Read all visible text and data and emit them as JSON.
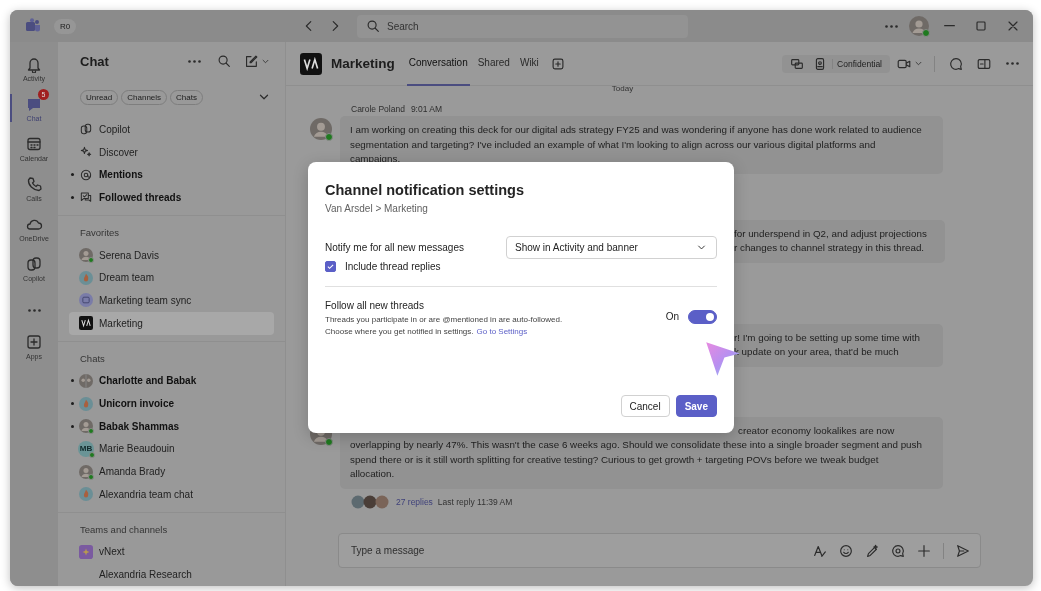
{
  "title_bar": {
    "account": "R0",
    "search": {
      "placeholder": "Search"
    }
  },
  "app_bar": [
    {
      "kind": "bell",
      "label": "Activity",
      "selected": false
    },
    {
      "kind": "chat",
      "label": "Chat",
      "selected": true,
      "badge": "5"
    },
    {
      "kind": "calendar",
      "label": "Calendar",
      "selected": false
    },
    {
      "kind": "phone",
      "label": "Calls",
      "selected": false
    },
    {
      "kind": "cloud",
      "label": "OneDrive",
      "selected": false
    },
    {
      "kind": "copilot",
      "label": "Copilot",
      "selected": false
    },
    {
      "kind": "more",
      "selected": false
    },
    {
      "kind": "apps",
      "label": "Apps",
      "selected": false
    }
  ],
  "chat_list": {
    "title": "Chat",
    "filters": [
      {
        "label": "Unread",
        "selected": false
      },
      {
        "label": "Channels",
        "selected": false
      },
      {
        "label": "Chats",
        "selected": false
      }
    ],
    "sections": [
      {
        "items": [
          {
            "kind": "copilot",
            "label": "Copilot",
            "unread": false,
            "selected": false
          },
          {
            "kind": "sparkle",
            "label": "Discover",
            "unread": false,
            "selected": false
          },
          {
            "kind": "mention",
            "label": "Mentions",
            "unread": true,
            "selected": false
          },
          {
            "kind": "threads",
            "label": "Followed threads",
            "unread": true,
            "selected": false
          }
        ]
      },
      {
        "heading": "Favorites",
        "items": [
          {
            "kind": "person",
            "label": "Serena Davis",
            "online": true,
            "unread": false,
            "selected": false
          },
          {
            "kind": "group",
            "label": "Dream team",
            "unread": false,
            "selected": false
          },
          {
            "kind": "meeting",
            "label": "Marketing team sync",
            "unread": false,
            "selected": false
          },
          {
            "kind": "channel-logo",
            "label": "Marketing",
            "unread": false,
            "selected": true
          }
        ]
      },
      {
        "heading": "Chats",
        "items": [
          {
            "kind": "pair",
            "label": "Charlotte and Babak",
            "unread": true,
            "selected": false
          },
          {
            "kind": "group",
            "label": "Unicorn invoice",
            "unread": true,
            "selected": false
          },
          {
            "kind": "person",
            "label": "Babak Shammas",
            "online": true,
            "unread": true,
            "selected": false
          },
          {
            "kind": "initials",
            "initials": "MB",
            "label": "Marie Beaudouin",
            "online": true,
            "unread": false,
            "selected": false
          },
          {
            "kind": "person",
            "label": "Amanda Brady",
            "online": true,
            "unread": false,
            "selected": false
          },
          {
            "kind": "group",
            "label": "Alexandria team chat",
            "unread": false,
            "selected": false
          }
        ]
      },
      {
        "heading": "Teams and channels",
        "items": [
          {
            "kind": "team",
            "label": "vNext",
            "unread": false,
            "selected": false
          },
          {
            "kind": "none",
            "label": "Alexandria Research",
            "unread": false,
            "selected": false
          }
        ]
      }
    ]
  },
  "channel": {
    "name": "Marketing",
    "tabs": [
      {
        "label": "Conversation",
        "selected": true
      },
      {
        "label": "Shared",
        "selected": false
      },
      {
        "label": "Wiki",
        "selected": false
      }
    ],
    "sensitivity": "Confidential",
    "day": "Today",
    "messages": [
      {
        "author": "Carole Poland",
        "time": "9:01 AM",
        "text": "I am working on creating this deck for our digital ads strategy FY25 and was wondering if anyone has done work related to audience segmentation and targeting? I've included an example of what I'm looking to align across our various digital platforms and campaigns."
      },
      {
        "covered_lines": [
          "for underspend in Q2, and adjust projections",
          "r changes to channel strategy in this thread."
        ]
      },
      {
        "covered_lines": [
          "r! I'm going to be setting up some time with",
          "k update on your area, that'd be much"
        ]
      },
      {
        "avatar": true,
        "covered_lines": [
          "creator economy lookalikes are now"
        ],
        "text": "overlapping by nearly 47%. This wasn't the case 6 weeks ago. Should we consolidate these into a single broader segment and push spend there or is it still worth splitting for creative testing? Curious to get growth + targeting POVs before we tweak budget allocation.",
        "replies": {
          "count": "27 replies",
          "last": "Last reply 11:39 AM"
        }
      }
    ],
    "composer": {
      "placeholder": "Type a message"
    }
  },
  "dialog": {
    "title": "Channel notification settings",
    "path": "Van Arsdel > Marketing",
    "notify": {
      "label": "Notify me for all new messages",
      "value": "Show in Activity and banner"
    },
    "include_replies": {
      "label": "Include thread replies",
      "checked": true
    },
    "follow": {
      "title": "Follow all new threads",
      "description": "Threads you participate in or are @mentioned in are auto-followed.",
      "hint": "Choose where you get notified in settings.",
      "link": "Go to Settings",
      "toggle_label": "On",
      "on": true
    },
    "buttons": [
      {
        "kind": "secondary",
        "label": "Cancel"
      },
      {
        "kind": "primary",
        "label": "Save"
      }
    ]
  }
}
